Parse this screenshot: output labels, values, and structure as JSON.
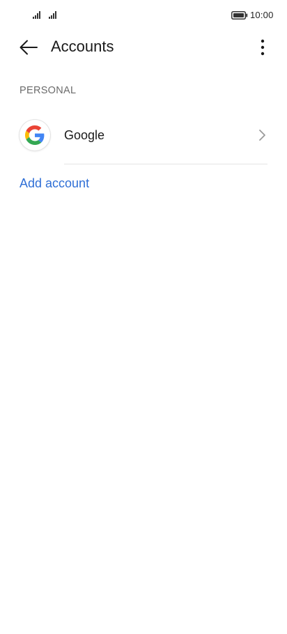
{
  "status_bar": {
    "time": "10:00",
    "icons": [
      "signal-icon",
      "signal-icon",
      "battery-icon"
    ]
  },
  "header": {
    "title": "Accounts",
    "back_icon": "arrow-left-icon",
    "menu_icon": "more-vertical-icon"
  },
  "section": {
    "label": "PERSONAL"
  },
  "accounts": [
    {
      "name": "Google",
      "icon": "google-logo-icon",
      "trailing_icon": "chevron-right-icon"
    }
  ],
  "actions": {
    "add_account": "Add account"
  },
  "colors": {
    "accent": "#2f6fd6",
    "section_label": "#6b6b6b",
    "divider": "#e4e4e4"
  }
}
